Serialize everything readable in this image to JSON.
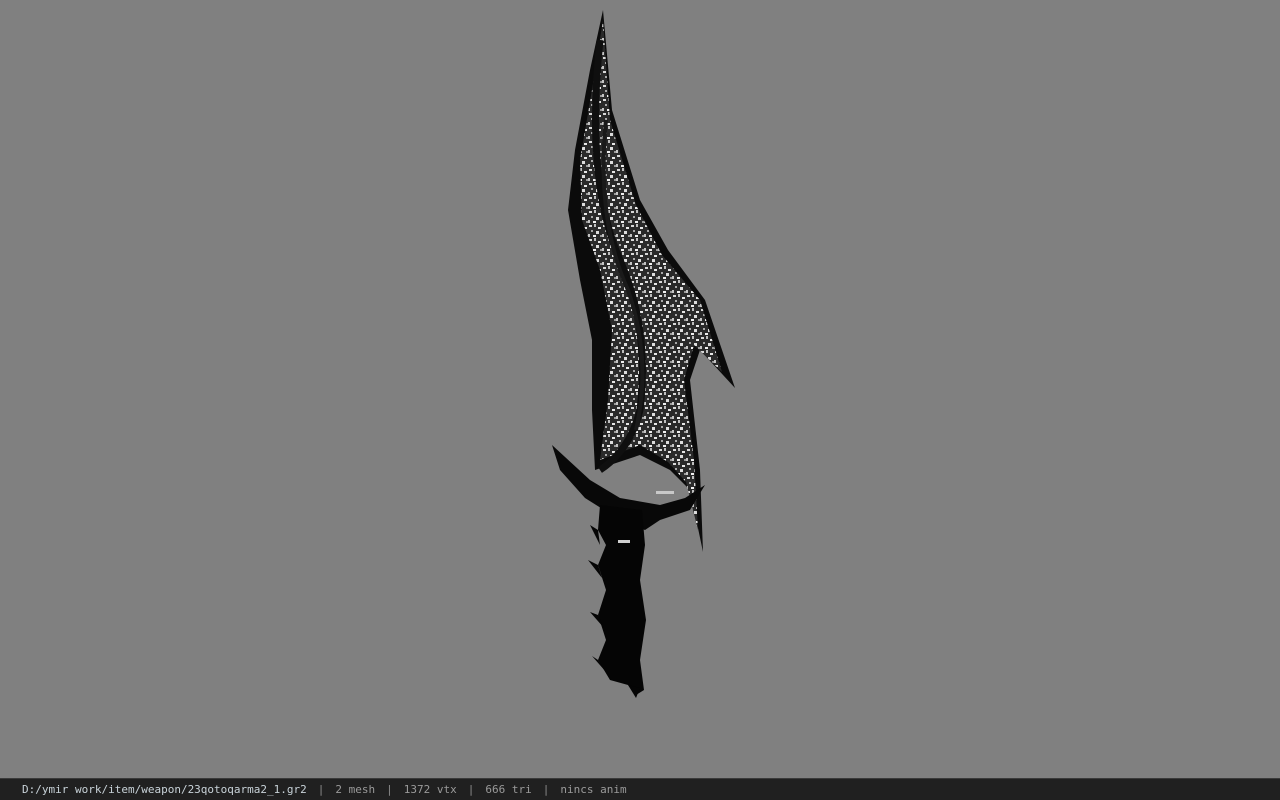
{
  "statusbar": {
    "file_path": "D:/ymir work/item/weapon/23qotoqarma2_1.gr2",
    "mesh_count": "2 mesh",
    "vertex_count": "1372 vtx",
    "triangle_count": "666 tri",
    "animation": "nincs anim",
    "separator": "|"
  },
  "viewport": {
    "background_color": "#808080",
    "model": "dagger-model"
  }
}
